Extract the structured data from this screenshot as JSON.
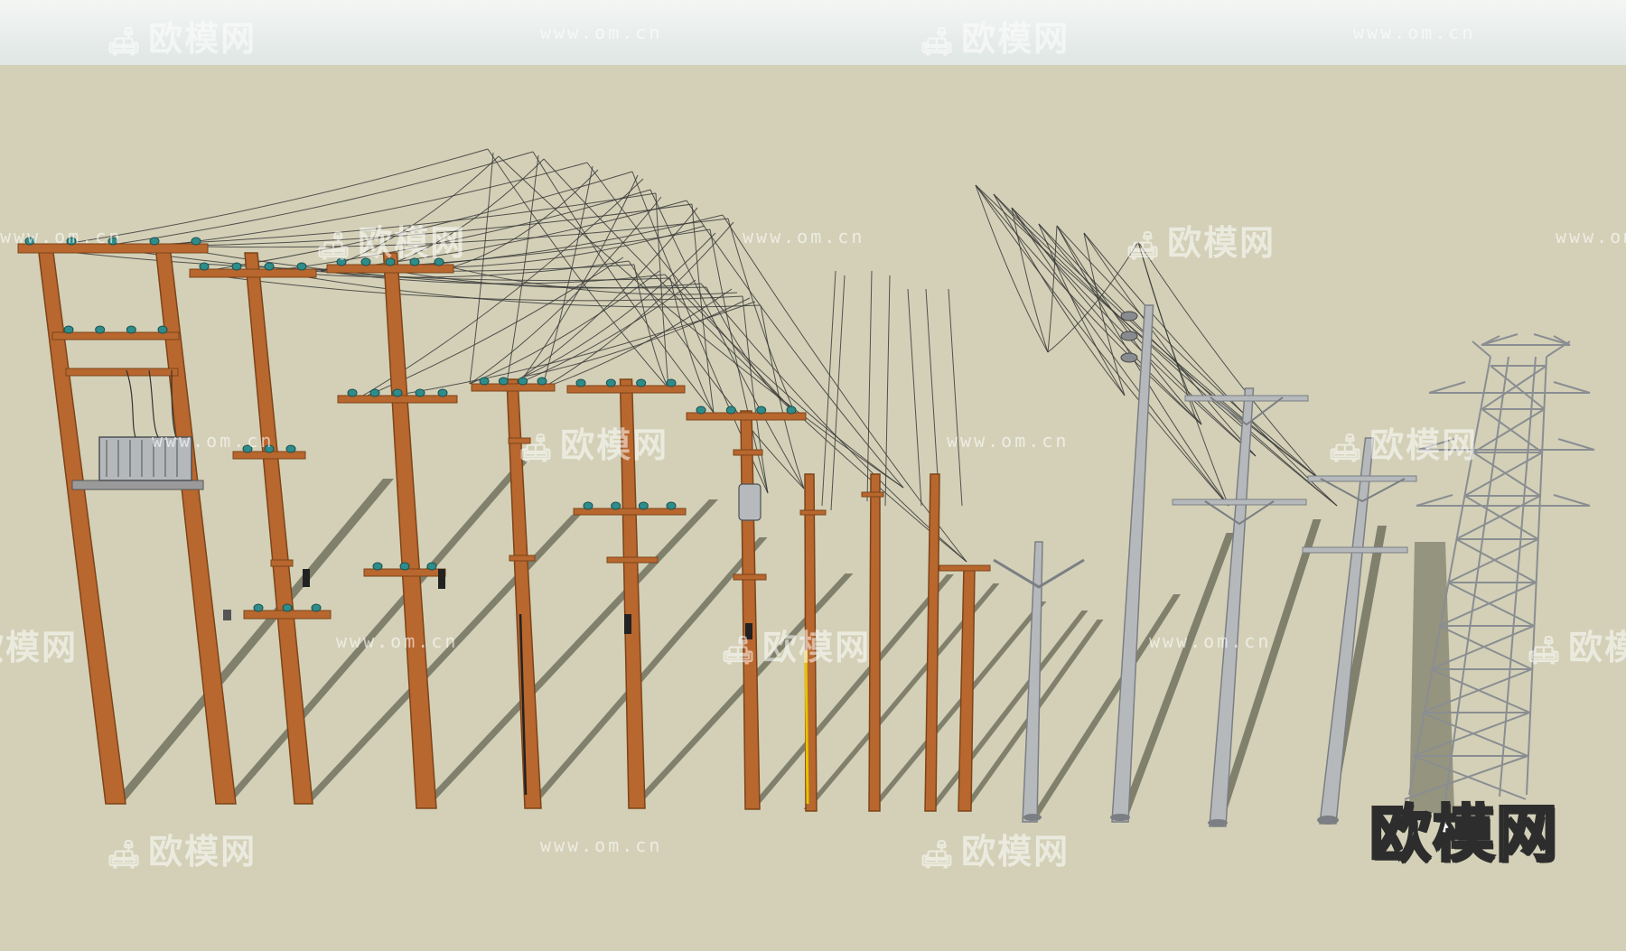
{
  "watermark": {
    "brand": "欧模网",
    "url": "www.om.cn",
    "corner_brand": "欧模网"
  },
  "scene": {
    "sky_color": "#e7ecea",
    "ground_color": "#d3d0b7",
    "shadow_color": "#6c6c5a",
    "wire_color": "#3a3a3a",
    "wood_color": "#b8672e",
    "wood_dark": "#7d4419",
    "steel_color": "#b6b9bc",
    "steel_dark": "#7b7f83",
    "insulator_color": "#2e8c8a",
    "objects": [
      "transformer-h-frame-pole",
      "wood-pole-three-crossarms",
      "wood-pole-two-crossarms",
      "wood-pole-service-drop",
      "wood-pole-double-crossarm",
      "wood-pole-transformer-can",
      "wood-pole-plain-a",
      "wood-pole-plain-b",
      "wood-pole-plain-c",
      "wood-pole-plain-d",
      "steel-pole-v-arm",
      "steel-pole-vertical-insulators",
      "steel-pole-double-crossarm",
      "steel-pole-twin-crossarm",
      "lattice-transmission-tower"
    ]
  }
}
